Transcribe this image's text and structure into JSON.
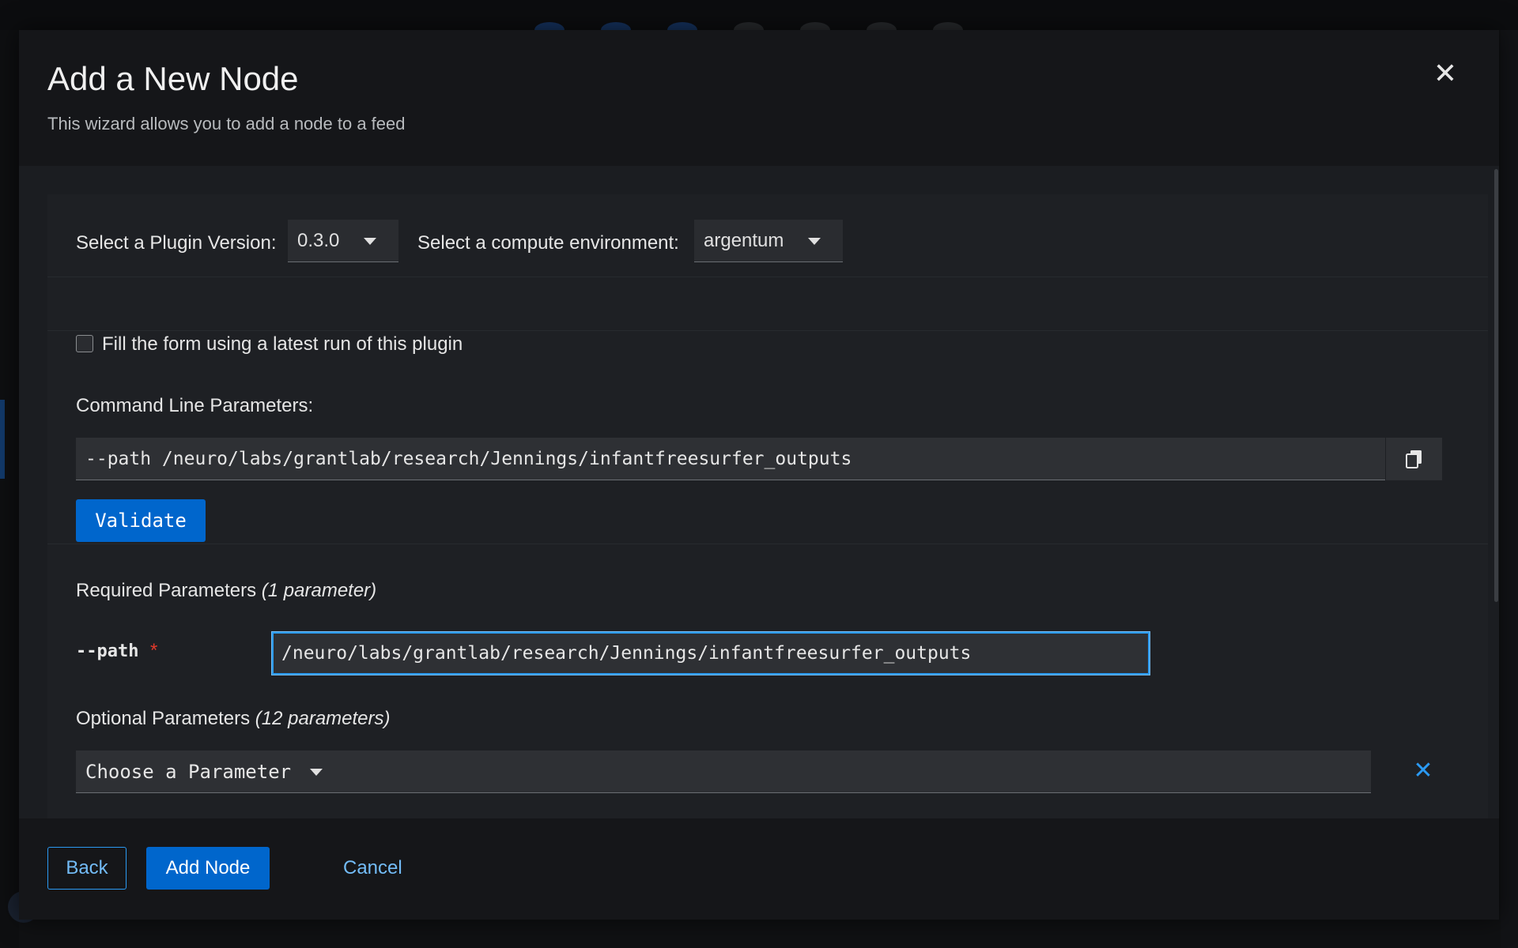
{
  "modal": {
    "title": "Add a New Node",
    "subtitle": "This wizard allows you to add a node to a feed"
  },
  "plugin_version": {
    "label": "Select a Plugin Version:",
    "value": "0.3.0"
  },
  "compute_env": {
    "label": "Select a compute environment:",
    "value": "argentum"
  },
  "fill_latest": {
    "label": "Fill the form using a latest run of this plugin",
    "checked": false
  },
  "command_line": {
    "label": "Command Line Parameters:",
    "value": "--path /neuro/labs/grantlab/research/Jennings/infantfreesurfer_outputs",
    "validate_label": "Validate"
  },
  "required": {
    "heading": "Required Parameters",
    "count": "(1 parameter)",
    "params": [
      {
        "name": "--path",
        "required_mark": "*",
        "value": "/neuro/labs/grantlab/research/Jennings/infantfreesurfer_outputs"
      }
    ]
  },
  "optional": {
    "heading": "Optional Parameters",
    "count": "(12 parameters)",
    "select_placeholder": "Choose a Parameter"
  },
  "footer": {
    "back_label": "Back",
    "add_label": "Add Node",
    "cancel_label": "Cancel"
  },
  "icons": {
    "close": "close-icon",
    "copy": "copy-icon",
    "remove": "remove-icon",
    "caret": "caret-down-icon"
  },
  "colors": {
    "accent": "#0066cc",
    "link": "#73bcf7",
    "required": "#e0392b"
  }
}
